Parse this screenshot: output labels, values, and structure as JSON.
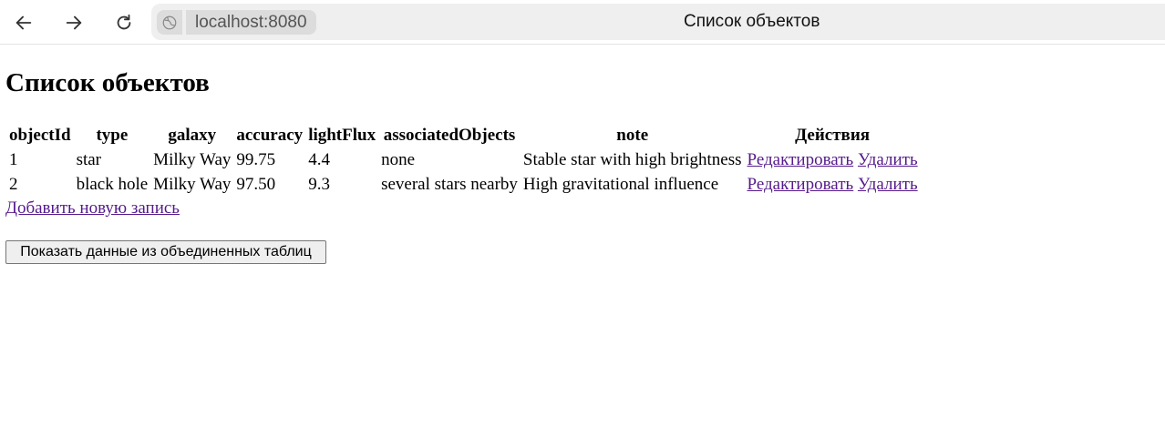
{
  "browser": {
    "url": "localhost:8080",
    "tab_title": "Список объектов"
  },
  "page": {
    "title": "Список объектов",
    "table": {
      "headers": [
        "objectId",
        "type",
        "galaxy",
        "accuracy",
        "lightFlux",
        "associatedObjects",
        "note",
        "Действия"
      ],
      "rows": [
        {
          "objectId": "1",
          "type": "star",
          "galaxy": "Milky Way",
          "accuracy": "99.75",
          "lightFlux": "4.4",
          "associatedObjects": "none",
          "note": "Stable star with high brightness",
          "edit_label": "Редактировать",
          "delete_label": "Удалить"
        },
        {
          "objectId": "2",
          "type": "black hole",
          "galaxy": "Milky Way",
          "accuracy": "97.50",
          "lightFlux": "9.3",
          "associatedObjects": "several stars nearby",
          "note": "High gravitational influence",
          "edit_label": "Редактировать",
          "delete_label": "Удалить"
        }
      ]
    },
    "add_link_label": "Добавить новую запись",
    "join_button_label": "Показать данные из объединенных таблиц"
  },
  "icons": {
    "back": "arrow-left-icon",
    "forward": "arrow-right-icon",
    "reload": "reload-icon",
    "site": "globe-icon"
  },
  "colors": {
    "link": "#551a8b",
    "address_bar_bg": "#efefef",
    "url_pill_bg": "#dcdcdc"
  }
}
